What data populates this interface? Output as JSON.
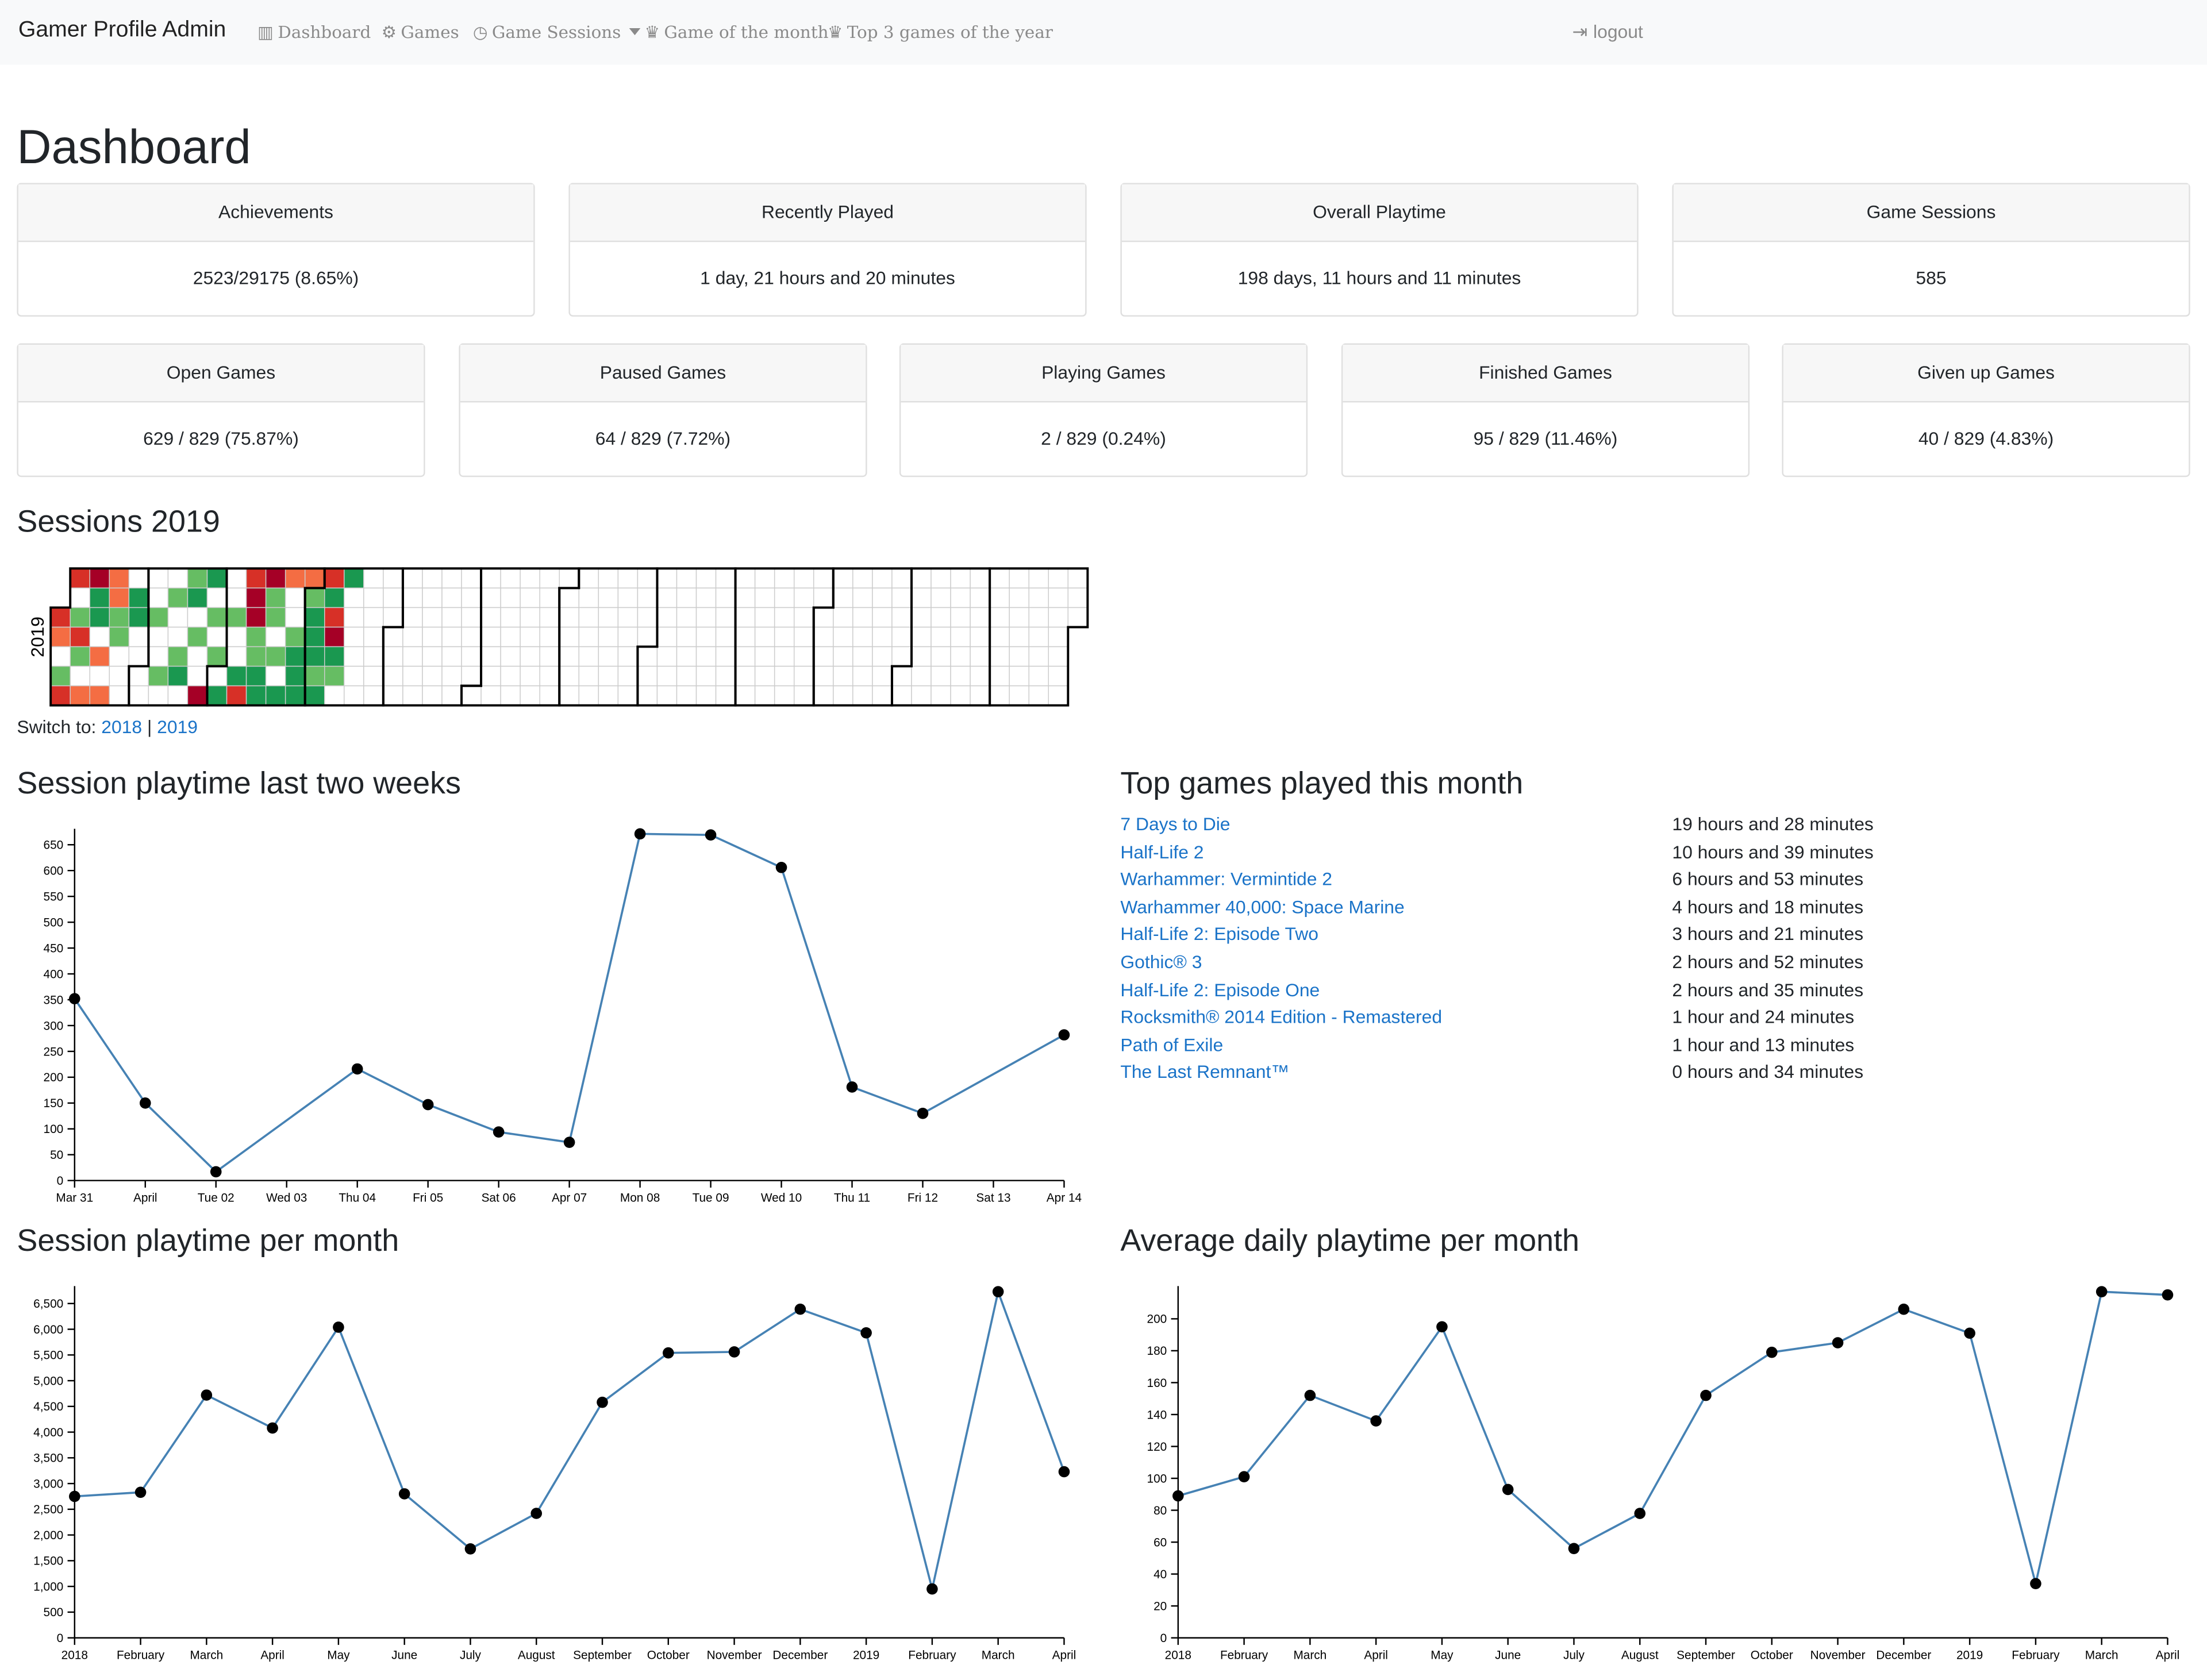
{
  "nav": {
    "brand": "Gamer Profile Admin",
    "items": [
      {
        "label": "Dashboard",
        "icon": "bar-chart-icon"
      },
      {
        "label": "Games",
        "icon": "steam-icon"
      },
      {
        "label": "Game Sessions",
        "icon": "clock-icon"
      },
      {
        "label": "Game of the month",
        "icon": "trophy-icon"
      },
      {
        "label": "Top 3 games of the year",
        "icon": "trophy-icon"
      }
    ],
    "logout": "logout"
  },
  "page_title": "Dashboard",
  "stats_row1": [
    {
      "title": "Achievements",
      "value": "2523/29175 (8.65%)"
    },
    {
      "title": "Recently Played",
      "value": "1 day, 21 hours and 20 minutes"
    },
    {
      "title": "Overall Playtime",
      "value": "198 days, 11 hours and 11 minutes"
    },
    {
      "title": "Game Sessions",
      "value": "585"
    }
  ],
  "stats_row2": [
    {
      "title": "Open Games",
      "value": "629 / 829 (75.87%)"
    },
    {
      "title": "Paused Games",
      "value": "64 / 829 (7.72%)"
    },
    {
      "title": "Playing Games",
      "value": "2 / 829 (0.24%)"
    },
    {
      "title": "Finished Games",
      "value": "95 / 829 (11.46%)"
    },
    {
      "title": "Given up Games",
      "value": "40 / 829 (4.83%)"
    }
  ],
  "sessions": {
    "heading": "Sessions 2019",
    "year_label": "2019",
    "switch_label": "Switch to:",
    "switch_links": [
      "2018",
      "2019"
    ],
    "switch_sep": "|",
    "colors": {
      "dark-red": "#a50026",
      "red": "#d73027",
      "orange": "#f46d43",
      "light-green": "#66bd63",
      "green": "#1a9850",
      "empty": "#ffffff"
    }
  },
  "top_games": {
    "heading": "Top games played this month",
    "rows": [
      {
        "name": "7 Days to Die",
        "time": "19 hours and 28 minutes"
      },
      {
        "name": "Half-Life 2",
        "time": "10 hours and 39 minutes"
      },
      {
        "name": "Warhammer: Vermintide 2",
        "time": "6 hours and 53 minutes"
      },
      {
        "name": "Warhammer 40,000: Space Marine",
        "time": "4 hours and 18 minutes"
      },
      {
        "name": "Half-Life 2: Episode Two",
        "time": "3 hours and 21 minutes"
      },
      {
        "name": "Gothic® 3",
        "time": "2 hours and 52 minutes"
      },
      {
        "name": "Half-Life 2: Episode One",
        "time": "2 hours and 35 minutes"
      },
      {
        "name": "Rocksmith® 2014 Edition - Remastered",
        "time": "1 hour and 24 minutes"
      },
      {
        "name": "Path of Exile",
        "time": "1 hour and 13 minutes"
      },
      {
        "name": "The Last Remnant™",
        "time": "0 hours and 34 minutes"
      }
    ]
  },
  "chart_data": [
    {
      "id": "two-weeks",
      "type": "line",
      "title": "Session playtime last two weeks",
      "x": [
        "Mar 31",
        "April",
        "Tue 02",
        "Wed 03",
        "Thu 04",
        "Fri 05",
        "Sat 06",
        "Apr 07",
        "Mon 08",
        "Tue 09",
        "Wed 10",
        "Thu 11",
        "Fri 12",
        "Sat 13",
        "Apr 14"
      ],
      "points": [
        {
          "x": 0,
          "y": 352
        },
        {
          "x": 1,
          "y": 150
        },
        {
          "x": 2,
          "y": 17
        },
        {
          "x": 4,
          "y": 216
        },
        {
          "x": 5,
          "y": 147
        },
        {
          "x": 6,
          "y": 94
        },
        {
          "x": 7,
          "y": 74
        },
        {
          "x": 8,
          "y": 671
        },
        {
          "x": 9,
          "y": 669
        },
        {
          "x": 10,
          "y": 606
        },
        {
          "x": 11,
          "y": 181
        },
        {
          "x": 12,
          "y": 130
        },
        {
          "x": 14,
          "y": 282
        }
      ],
      "yticks": [
        0,
        50,
        100,
        150,
        200,
        250,
        300,
        350,
        400,
        450,
        500,
        550,
        600,
        650
      ],
      "ylim": [
        0,
        670
      ],
      "color": "#4682b4"
    },
    {
      "id": "per-month",
      "type": "line",
      "title": "Session playtime per month",
      "x": [
        "2018",
        "February",
        "March",
        "April",
        "May",
        "June",
        "July",
        "August",
        "September",
        "October",
        "November",
        "December",
        "2019",
        "February",
        "March",
        "April"
      ],
      "points": [
        {
          "x": 0,
          "y": 2750
        },
        {
          "x": 1,
          "y": 2830
        },
        {
          "x": 2,
          "y": 4720
        },
        {
          "x": 3,
          "y": 4080
        },
        {
          "x": 4,
          "y": 6040
        },
        {
          "x": 5,
          "y": 2800
        },
        {
          "x": 6,
          "y": 1730
        },
        {
          "x": 7,
          "y": 2420
        },
        {
          "x": 8,
          "y": 4580
        },
        {
          "x": 9,
          "y": 5540
        },
        {
          "x": 10,
          "y": 5560
        },
        {
          "x": 11,
          "y": 6390
        },
        {
          "x": 12,
          "y": 5930
        },
        {
          "x": 13,
          "y": 950
        },
        {
          "x": 14,
          "y": 6730
        },
        {
          "x": 15,
          "y": 3230
        }
      ],
      "yticks": [
        0,
        500,
        1000,
        1500,
        2000,
        2500,
        3000,
        3500,
        4000,
        4500,
        5000,
        5500,
        6000,
        6500
      ],
      "ytick_labels": [
        "0",
        "500",
        "1,000",
        "1,500",
        "2,000",
        "2,500",
        "3,000",
        "3,500",
        "4,000",
        "4,500",
        "5,000",
        "5,500",
        "6,000",
        "6,500"
      ],
      "ylim": [
        0,
        6730
      ],
      "color": "#4682b4"
    },
    {
      "id": "avg-daily",
      "type": "line",
      "title": "Average daily playtime per month",
      "x": [
        "2018",
        "February",
        "March",
        "April",
        "May",
        "June",
        "July",
        "August",
        "September",
        "October",
        "November",
        "December",
        "2019",
        "February",
        "March",
        "April"
      ],
      "points": [
        {
          "x": 0,
          "y": 89
        },
        {
          "x": 1,
          "y": 101
        },
        {
          "x": 2,
          "y": 152
        },
        {
          "x": 3,
          "y": 136
        },
        {
          "x": 4,
          "y": 195
        },
        {
          "x": 5,
          "y": 93
        },
        {
          "x": 6,
          "y": 56
        },
        {
          "x": 7,
          "y": 78
        },
        {
          "x": 8,
          "y": 152
        },
        {
          "x": 9,
          "y": 179
        },
        {
          "x": 10,
          "y": 185
        },
        {
          "x": 11,
          "y": 206
        },
        {
          "x": 12,
          "y": 191
        },
        {
          "x": 13,
          "y": 34
        },
        {
          "x": 14,
          "y": 217
        },
        {
          "x": 15,
          "y": 215
        }
      ],
      "yticks": [
        0,
        20,
        40,
        60,
        80,
        100,
        120,
        140,
        160,
        180,
        200
      ],
      "ylim": [
        0,
        217
      ],
      "color": "#4682b4"
    }
  ]
}
